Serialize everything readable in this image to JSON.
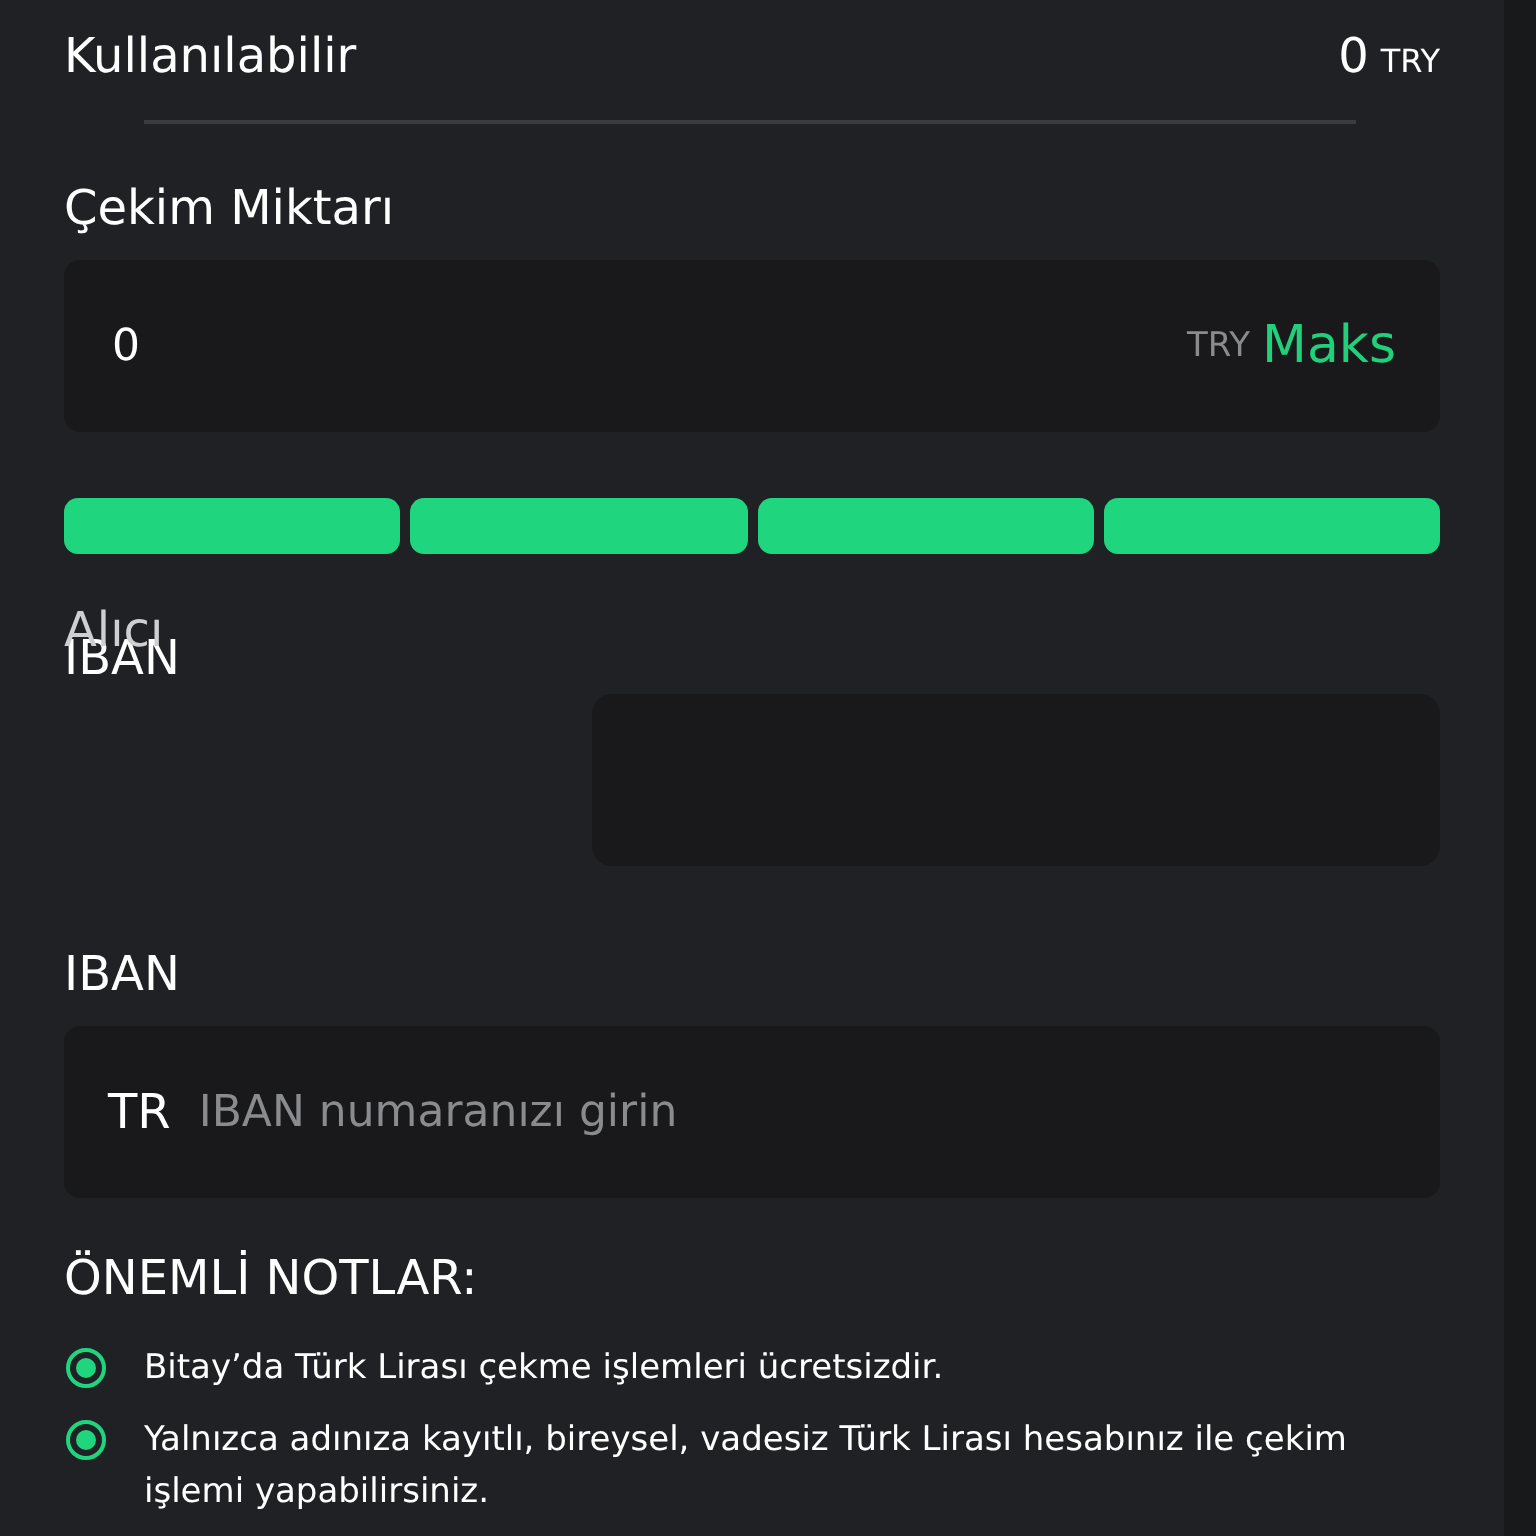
{
  "available": {
    "label": "Kullanılabilir",
    "amount": "0",
    "currency": "TRY"
  },
  "withdraw": {
    "label": "Çekim Miktarı",
    "value": "0",
    "currency": "TRY",
    "max_button": "Maks"
  },
  "percent_segments": [
    {
      "selected": true
    },
    {
      "selected": true
    },
    {
      "selected": true
    },
    {
      "selected": true
    }
  ],
  "recipient": {
    "label_back": "Alıcı",
    "label_front": "IBAN"
  },
  "iban": {
    "label": "IBAN",
    "prefix": "TR",
    "placeholder": "IBAN numaranızı girin"
  },
  "notes": {
    "title": "ÖNEMLİ NOTLAR:",
    "items": [
      "Bitay’da Türk Lirası çekme işlemleri ücretsizdir.",
      "Yalnızca adınıza kayıtlı, bireysel, vadesiz Türk Lirası hesabınız ile çekim işlemi yapabilirsiniz."
    ]
  }
}
